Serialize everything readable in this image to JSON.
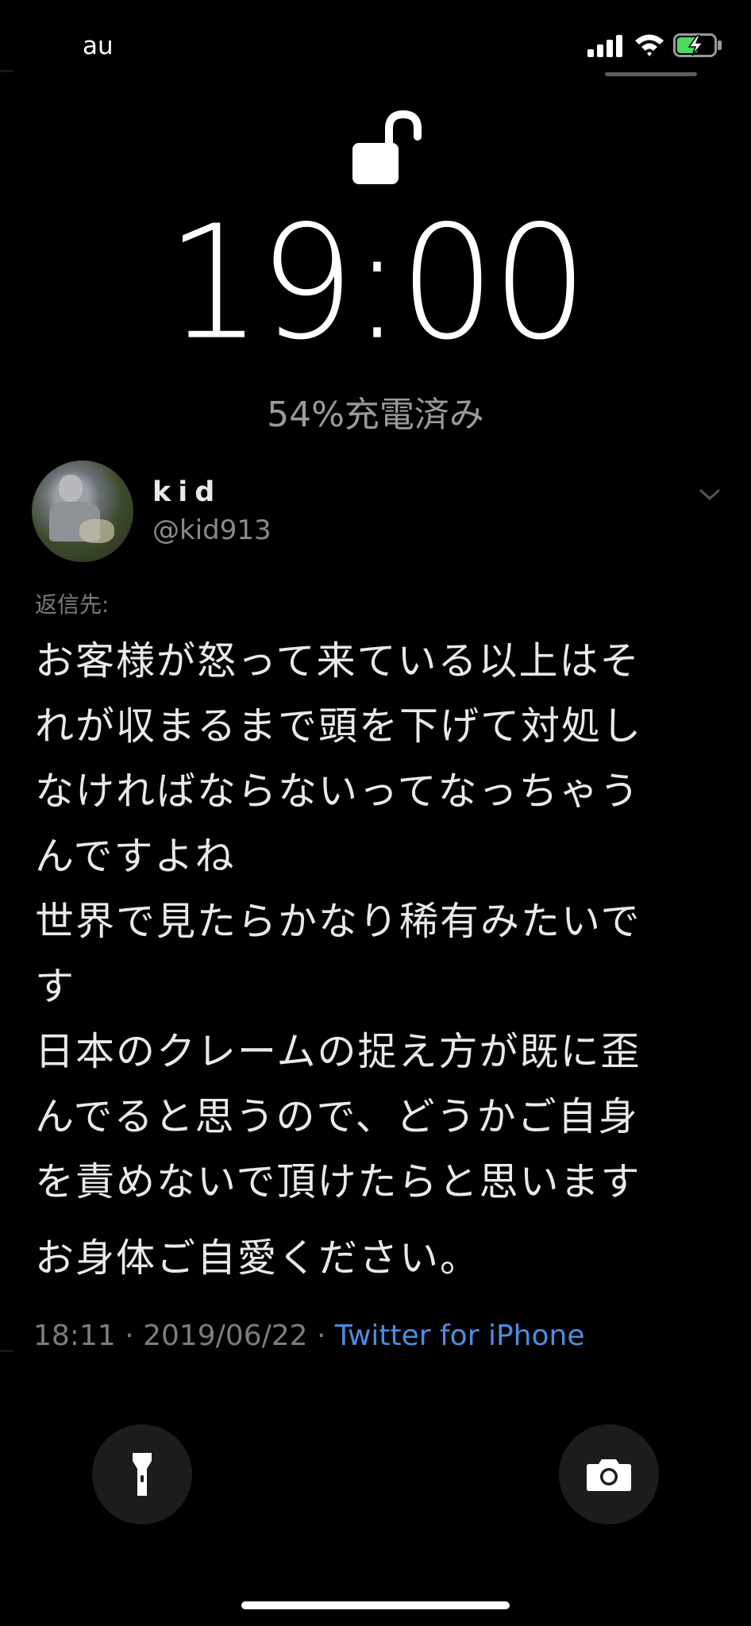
{
  "status_bar": {
    "carrier": "au",
    "signal_icon": "signal-bars-icon",
    "wifi_icon": "wifi-icon",
    "battery_icon": "battery-charging-icon",
    "battery_color": "#4cd964"
  },
  "lock_screen": {
    "lock_icon": "unlocked-padlock-icon",
    "time": "19:00",
    "charge_status": "54%充電済み"
  },
  "tweet": {
    "display_name": "kid",
    "handle": "@kid913",
    "reply_label": "返信先:",
    "body_lines": [
      "お客様が怒って来ている以上はそ",
      "れが収まるまで頭を下げて対処し",
      "なければならないってなっちゃう",
      "んですよね",
      "世界で見たらかなり稀有みたいで",
      "す",
      "日本のクレームの捉え方が既に歪",
      "んでると思うので、どうかご自身",
      "を責めないで頂けたらと思います"
    ],
    "closing": "お身体ご自愛ください。",
    "meta_time": "18:11 · 2019/06/22 · ",
    "meta_source": "Twitter for iPhone",
    "source_color": "#4d8ee0"
  },
  "controls": {
    "flashlight_icon": "flashlight-icon",
    "camera_icon": "camera-icon"
  }
}
